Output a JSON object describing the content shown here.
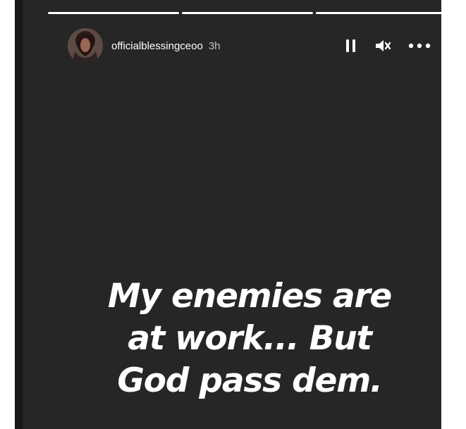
{
  "story": {
    "username": "officialblessingceoo",
    "time_ago": "3h",
    "text_lines": [
      "My enemies are",
      "at work... But",
      "God pass dem."
    ],
    "progress": [
      1,
      1,
      1
    ]
  },
  "controls": {
    "pause_icon": "pause-icon",
    "mute_icon": "mute-icon",
    "more_icon": "more-options-icon"
  },
  "colors": {
    "story_background": "#262626",
    "text": "#ffffff",
    "side_bar": "#181818"
  }
}
